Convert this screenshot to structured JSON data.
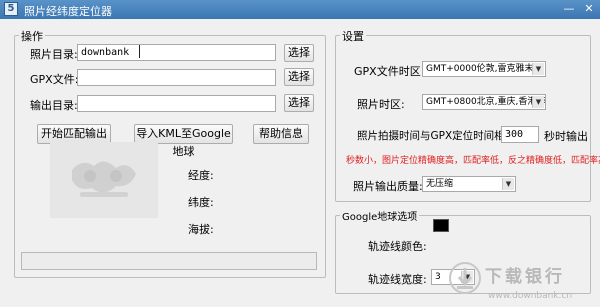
{
  "window": {
    "title": "照片经纬度定位器",
    "icon_letter": "5",
    "min_glyph": "—",
    "close_glyph": "✕"
  },
  "operate": {
    "group_title": "操作",
    "photo_dir_label": "照片目录:",
    "photo_dir_value": "downbank",
    "gpx_file_label": "GPX文件:",
    "gpx_file_value": "",
    "output_dir_label": "输出目录:",
    "output_dir_value": "",
    "browse_label": "选择",
    "start_button": "开始匹配输出",
    "export_kml_button": "导入KML至Google地球",
    "help_button": "帮助信息",
    "longitude_label": "经度:",
    "latitude_label": "纬度:",
    "altitude_label": "海拔:"
  },
  "settings": {
    "group_title": "设置",
    "gpx_tz_label": "GPX文件时区:",
    "gpx_tz_value": "GMT+0000伦敦,雷克雅末",
    "photo_tz_label": "照片时区:",
    "photo_tz_value": "GMT+0800北京,重庆,香港,乌",
    "time_diff_prefix": "照片拍摄时间与GPX定位时间相差",
    "time_diff_value": "300",
    "time_diff_suffix": "秒时输出",
    "warning": "秒数小，图片定位精确度高，匹配率低，反之精确度低，匹配率高",
    "quality_label": "照片输出质量:",
    "quality_value": "无压缩"
  },
  "google": {
    "group_title": "Google地球选项",
    "track_color_label": "轨迹线颜色:",
    "track_color": "#000000",
    "track_width_label": "轨迹线宽度:",
    "track_width_value": "3"
  },
  "watermark": {
    "brand": "下载银行",
    "url": "www.downbank.cn"
  }
}
